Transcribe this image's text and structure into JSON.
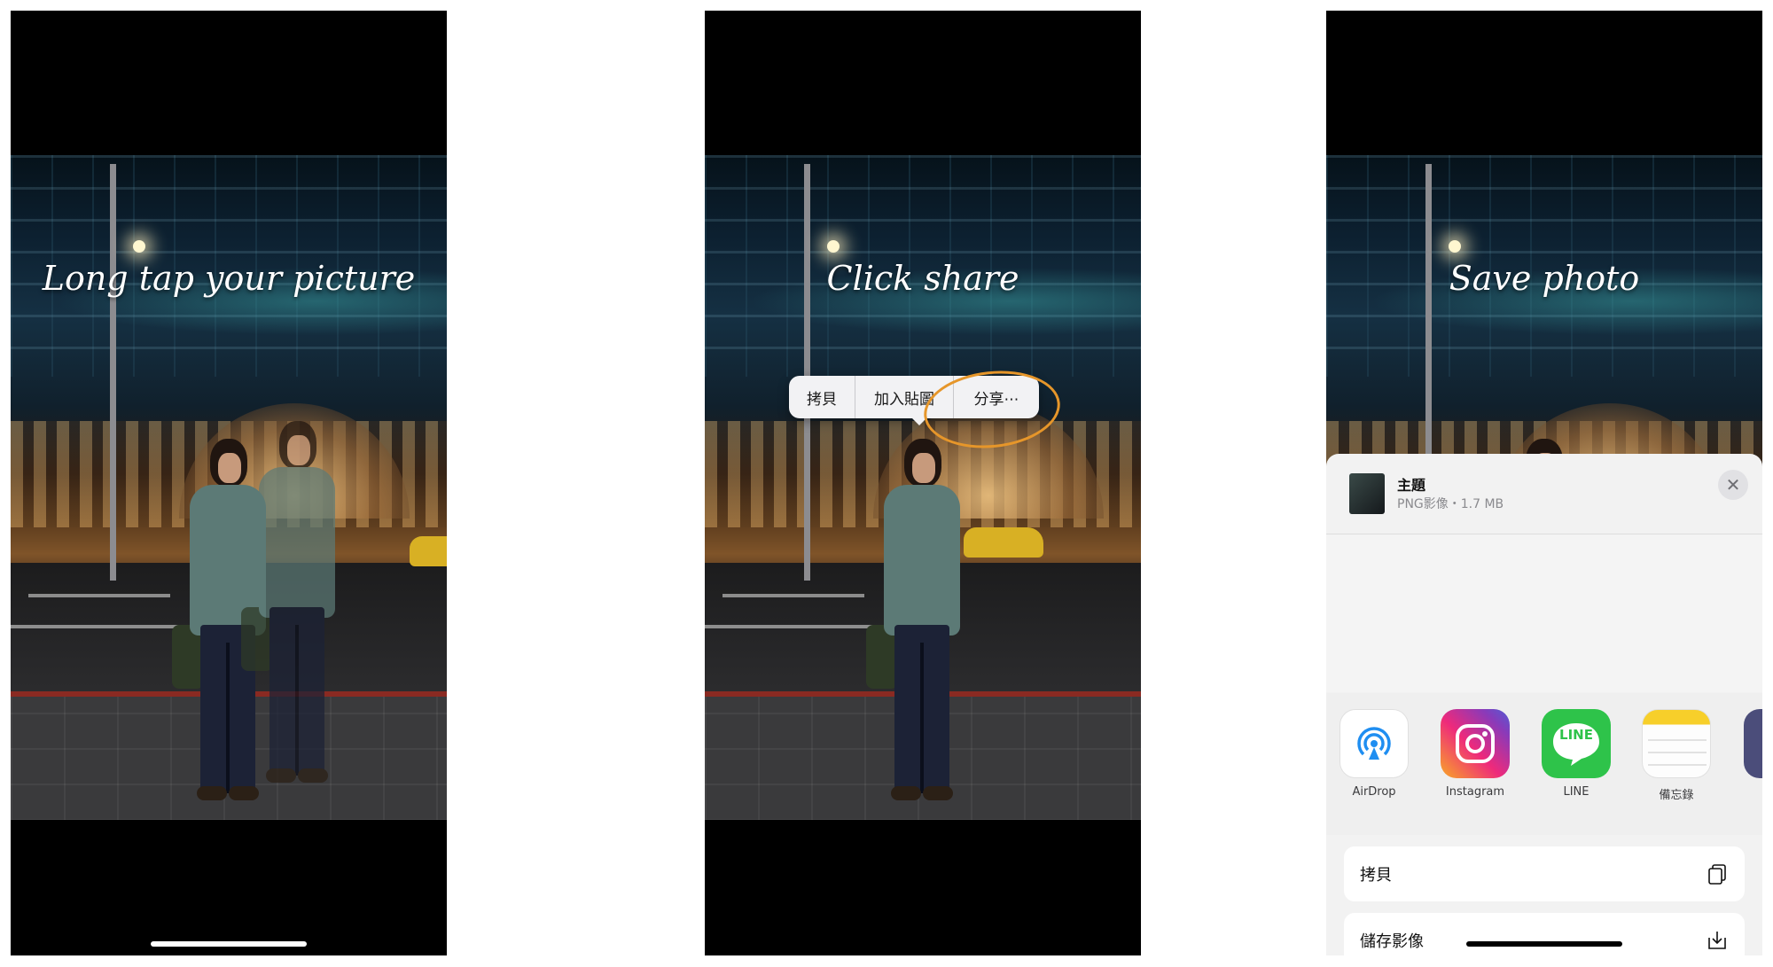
{
  "panels": [
    {
      "caption": "Long tap your picture"
    },
    {
      "caption": "Click share",
      "context_menu": {
        "items": [
          "拷貝",
          "加入貼圖",
          "分享⋯"
        ]
      }
    },
    {
      "caption": "Save photo",
      "share_sheet": {
        "title": "主題",
        "subtitle": "PNG影像・1.7 MB",
        "close_icon": "xmark-icon",
        "apps": [
          {
            "label": "AirDrop",
            "icon": "airdrop-icon"
          },
          {
            "label": "Instagram",
            "icon": "instagram-icon"
          },
          {
            "label": "LINE",
            "icon": "line-icon",
            "badge": "LINE"
          },
          {
            "label": "備忘錄",
            "icon": "notes-icon"
          }
        ],
        "actions": [
          {
            "label": "拷貝",
            "icon": "copy-icon"
          },
          {
            "label": "儲存影像",
            "icon": "save-image-icon"
          }
        ]
      }
    }
  ],
  "colors": {
    "highlight": "#e6962a",
    "line_green": "#2ec34a"
  }
}
